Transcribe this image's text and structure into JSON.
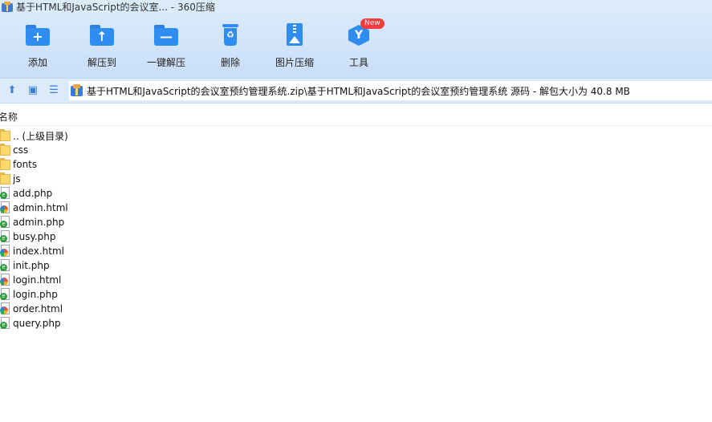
{
  "window": {
    "title": "基于HTML和JavaScript的会议室... - 360压缩"
  },
  "toolbar": {
    "add": "添加",
    "extract_to": "解压到",
    "one_click_extract": "一键解压",
    "delete": "删除",
    "image_compress": "图片压缩",
    "tools": "工具",
    "new_badge": "New"
  },
  "address": {
    "path": "基于HTML和JavaScript的会议室预约管理系统.zip\\基于HTML和JavaScript的会议室预约管理系统 源码 - 解包大小为 40.8 MB"
  },
  "list": {
    "column_name": "名称",
    "items": [
      {
        "name": ".. (上级目录)",
        "type": "folder"
      },
      {
        "name": "css",
        "type": "folder"
      },
      {
        "name": "fonts",
        "type": "folder"
      },
      {
        "name": "js",
        "type": "folder"
      },
      {
        "name": "add.php",
        "type": "php"
      },
      {
        "name": "admin.html",
        "type": "html"
      },
      {
        "name": "admin.php",
        "type": "php"
      },
      {
        "name": "busy.php",
        "type": "php"
      },
      {
        "name": "index.html",
        "type": "html"
      },
      {
        "name": "init.php",
        "type": "php"
      },
      {
        "name": "login.html",
        "type": "html"
      },
      {
        "name": "login.php",
        "type": "php"
      },
      {
        "name": "order.html",
        "type": "html"
      },
      {
        "name": "query.php",
        "type": "php"
      }
    ]
  },
  "icons": {
    "app": "archive-app-icon",
    "add": "add-folder-icon",
    "extract_to": "extract-folder-icon",
    "one_click_extract": "one-click-extract-icon",
    "delete": "recycle-bin-icon",
    "image_compress": "image-compress-icon",
    "tools": "tools-hex-icon",
    "up": "up-arrow-icon",
    "view_thumb": "thumbnail-view-icon",
    "view_list": "list-view-icon"
  },
  "colors": {
    "accent": "#2f8cf0",
    "toolbar_bg": "#d9e9fb",
    "badge": "#f23c3c"
  }
}
